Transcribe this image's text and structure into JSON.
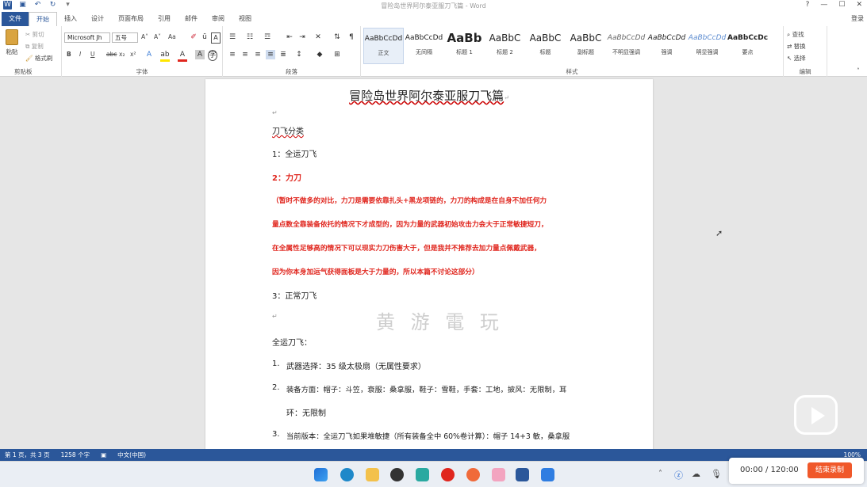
{
  "titlebar": {
    "title": "冒险岛世界阿尔泰亚服刀飞篇 - Word",
    "help": "?",
    "minimize": "—",
    "maximize": "☐",
    "close": "✕"
  },
  "tabs": [
    "文件",
    "开始",
    "插入",
    "设计",
    "页面布局",
    "引用",
    "邮件",
    "审阅",
    "视图"
  ],
  "login": "登录",
  "clipboard": {
    "paste": "粘贴",
    "cut": "剪切",
    "copy": "复制",
    "format_painter": "格式刷",
    "label": "剪贴板"
  },
  "font": {
    "name": "Microsoft Jh",
    "size": "五号",
    "bold": "B",
    "italic": "I",
    "underline": "U",
    "strike": "abc",
    "subscript": "x₂",
    "superscript": "x²",
    "grow": "A˄",
    "shrink": "A˅",
    "case": "Aa",
    "label": "字体"
  },
  "paragraph": {
    "label": "段落"
  },
  "styles": {
    "items": [
      {
        "preview": "AaBbCcDd",
        "name": "正文"
      },
      {
        "preview": "AaBbCcDd",
        "name": "无间隔"
      },
      {
        "preview": "AaBb",
        "name": "标题 1"
      },
      {
        "preview": "AaBbC",
        "name": "标题 2"
      },
      {
        "preview": "AaBbC",
        "name": "标题"
      },
      {
        "preview": "AaBbC",
        "name": "副标题"
      },
      {
        "preview": "AaBbCcDd",
        "name": "不明显强调"
      },
      {
        "preview": "AaBbCcDd",
        "name": "强调"
      },
      {
        "preview": "AaBbCcDd",
        "name": "明显强调"
      },
      {
        "preview": "AaBbCcDc",
        "name": "要点"
      }
    ],
    "label": "样式"
  },
  "editing": {
    "find": "查找",
    "replace": "替换",
    "select": "选择",
    "label": "编辑"
  },
  "document": {
    "title": "冒险岛世界阿尔泰亚服刀飞篇",
    "lines": [
      "刀飞分类",
      "1：全运刀飞",
      "2：力刀",
      "（暂时不做多的对比，力刀是需要依靠扎头+黑龙项链的，力刀的构成是在自身不加任何力",
      "量点数全靠装备依托的情况下才成型的，因为力量的武器初始攻击力会大于正常敏捷短刀，",
      "在全属性足够高的情况下可以现实力刀伤害大于，但是我并不推荐去加力量点佩戴武器，",
      "因为你本身加运气获得面板是大于力量的，所以本篇不讨论这部分）",
      "3：正常刀飞",
      "全运刀飞：",
      "武器选择：35 级太极扇（无属性要求）",
      "装备方面：帽子：斗笠，衰服：桑拿服，鞋子：雪鞋，手套：工地，披风：无限制，耳",
      "环：无限制",
      "当前版本：全运刀飞如果堆敏捷（所有装备全中 60%卷计算）：帽子 14+3 敏，桑拿服"
    ],
    "num1": "1.",
    "num2": "2.",
    "num3": "3."
  },
  "watermark": "黄 游 電 玩",
  "status": {
    "page": "第 1 页，共 3 页",
    "words": "1258 个字",
    "lang": "中文(中国)",
    "zoom": "100%"
  },
  "recorder": {
    "time": "00:00 / 120:00",
    "stop": "结束录制"
  },
  "colors": {
    "brand": "#2b579a",
    "red_text": "#e0261e",
    "record": "#f0582a"
  }
}
